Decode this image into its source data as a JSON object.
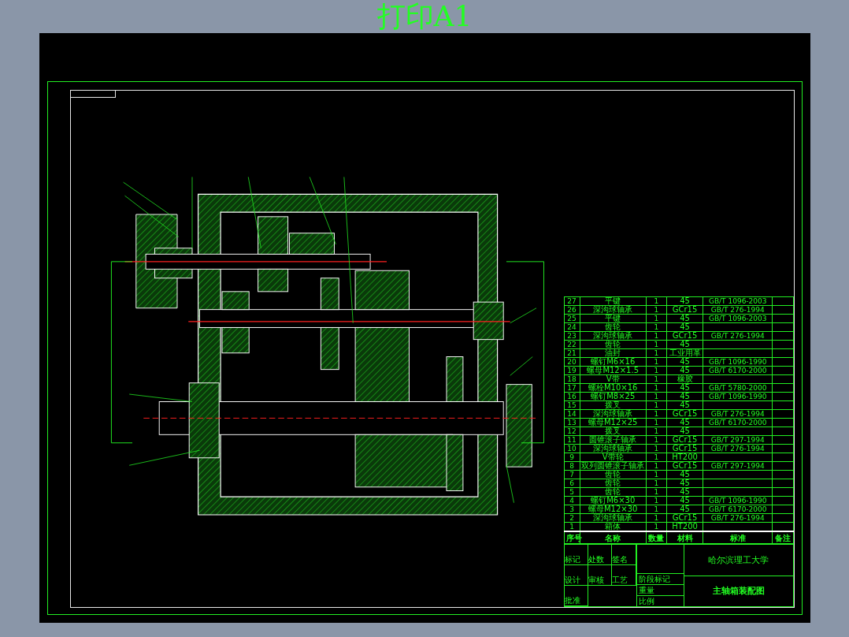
{
  "viewer": {
    "title": "打印A1"
  },
  "parts_table": {
    "columns": [
      "序号",
      "名称",
      "数量",
      "材料",
      "标准",
      "备注"
    ],
    "rows": [
      {
        "no": "27",
        "name": "平键",
        "qty": "1",
        "material": "45",
        "standard": "GB/T 1096-2003"
      },
      {
        "no": "26",
        "name": "深沟球轴承",
        "qty": "1",
        "material": "GCr15",
        "standard": "GB/T 276-1994"
      },
      {
        "no": "25",
        "name": "平键",
        "qty": "1",
        "material": "45",
        "standard": "GB/T 1096-2003"
      },
      {
        "no": "24",
        "name": "齿轮",
        "qty": "1",
        "material": "45",
        "standard": ""
      },
      {
        "no": "23",
        "name": "深沟球轴承",
        "qty": "1",
        "material": "GCr15",
        "standard": "GB/T 276-1994"
      },
      {
        "no": "22",
        "name": "齿轮",
        "qty": "1",
        "material": "45",
        "standard": ""
      },
      {
        "no": "21",
        "name": "油封",
        "qty": "1",
        "material": "工业用革",
        "standard": ""
      },
      {
        "no": "20",
        "name": "螺钉M6×16",
        "qty": "1",
        "material": "45",
        "standard": "GB/T 1096-1990"
      },
      {
        "no": "19",
        "name": "螺母M12×1.5",
        "qty": "1",
        "material": "45",
        "standard": "GB/T 6170-2000"
      },
      {
        "no": "18",
        "name": "V带",
        "qty": "1",
        "material": "橡胶",
        "standard": ""
      },
      {
        "no": "17",
        "name": "螺栓M10×16",
        "qty": "1",
        "material": "45",
        "standard": "GB/T 5780-2000"
      },
      {
        "no": "16",
        "name": "螺钉M8×25",
        "qty": "1",
        "material": "45",
        "standard": "GB/T 1096-1990"
      },
      {
        "no": "15",
        "name": "拨叉",
        "qty": "1",
        "material": "45",
        "standard": ""
      },
      {
        "no": "14",
        "name": "深沟球轴承",
        "qty": "1",
        "material": "GCr15",
        "standard": "GB/T 276-1994"
      },
      {
        "no": "13",
        "name": "螺母M12×25",
        "qty": "1",
        "material": "45",
        "standard": "GB/T 6170-2000"
      },
      {
        "no": "12",
        "name": "拨叉",
        "qty": "1",
        "material": "45",
        "standard": ""
      },
      {
        "no": "11",
        "name": "圆锥滚子轴承",
        "qty": "1",
        "material": "GCr15",
        "standard": "GB/T 297-1994"
      },
      {
        "no": "10",
        "name": "深沟球轴承",
        "qty": "1",
        "material": "GCr15",
        "standard": "GB/T 276-1994"
      },
      {
        "no": "9",
        "name": "V带轮",
        "qty": "1",
        "material": "HT200",
        "standard": ""
      },
      {
        "no": "8",
        "name": "双列圆锥滚子轴承",
        "qty": "1",
        "material": "GCr15",
        "standard": "GB/T 297-1994"
      },
      {
        "no": "7",
        "name": "齿轮",
        "qty": "1",
        "material": "45",
        "standard": ""
      },
      {
        "no": "6",
        "name": "齿轮",
        "qty": "1",
        "material": "45",
        "standard": ""
      },
      {
        "no": "5",
        "name": "齿轮",
        "qty": "1",
        "material": "45",
        "standard": ""
      },
      {
        "no": "4",
        "name": "螺钉M6×30",
        "qty": "1",
        "material": "45",
        "standard": "GB/T 1096-1990"
      },
      {
        "no": "3",
        "name": "螺母M12×30",
        "qty": "1",
        "material": "45",
        "standard": "GB/T 6170-2000"
      },
      {
        "no": "2",
        "name": "深沟球轴承",
        "qty": "1",
        "material": "GCr15",
        "standard": "GB/T 276-1994"
      },
      {
        "no": "1",
        "name": "箱体",
        "qty": "1",
        "material": "HT200",
        "standard": ""
      }
    ]
  },
  "title_block": {
    "school": "哈尔滨理工大学",
    "drawing_title": "主轴箱装配图",
    "labels": [
      "标记",
      "处数",
      "签名",
      "设计",
      "审核",
      "工艺",
      "批准"
    ],
    "stage_labels": [
      "阶段标记",
      "重量",
      "比例"
    ]
  }
}
